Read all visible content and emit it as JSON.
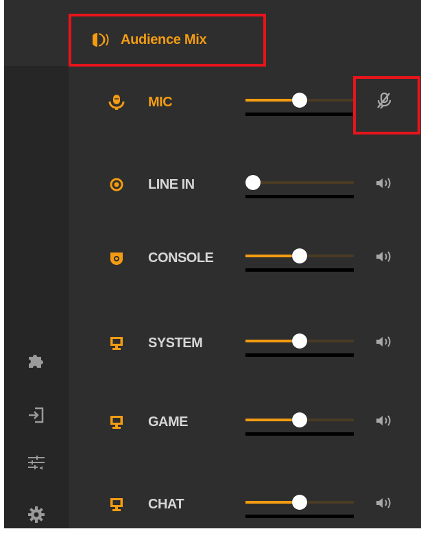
{
  "theme": {
    "accent": "#f39c12",
    "panel_bg": "#2e2e2e",
    "rail_bg": "#262626",
    "label_default": "#d6d6d6",
    "highlight": "#e8141b"
  },
  "sidebar": {
    "items": [
      {
        "icon": "puzzle-icon"
      },
      {
        "icon": "sign-in-icon"
      },
      {
        "icon": "mixer-sliders-icon"
      },
      {
        "icon": "gear-icon"
      }
    ]
  },
  "mix": {
    "title": "Audience Mix",
    "icon": "audience-speaker-icon"
  },
  "channels": [
    {
      "label": "MIC",
      "icon": "microphone-icon",
      "level": 0.5,
      "muted": true,
      "label_color": "#f39c12",
      "mute_icon": "mic-muted-icon"
    },
    {
      "label": "LINE IN",
      "icon": "line-in-icon",
      "level": 0.0,
      "muted": false,
      "label_color": "#d6d6d6",
      "mute_icon": "speaker-icon"
    },
    {
      "label": "CONSOLE",
      "icon": "console-icon",
      "level": 0.5,
      "muted": false,
      "label_color": "#d6d6d6",
      "mute_icon": "speaker-icon"
    },
    {
      "label": "SYSTEM",
      "icon": "monitor-icon",
      "level": 0.5,
      "muted": false,
      "label_color": "#d6d6d6",
      "mute_icon": "speaker-icon"
    },
    {
      "label": "GAME",
      "icon": "monitor-icon",
      "level": 0.5,
      "muted": false,
      "label_color": "#d6d6d6",
      "mute_icon": "speaker-icon"
    },
    {
      "label": "CHAT",
      "icon": "monitor-icon",
      "level": 0.5,
      "muted": false,
      "label_color": "#d6d6d6",
      "mute_icon": "speaker-icon"
    }
  ]
}
